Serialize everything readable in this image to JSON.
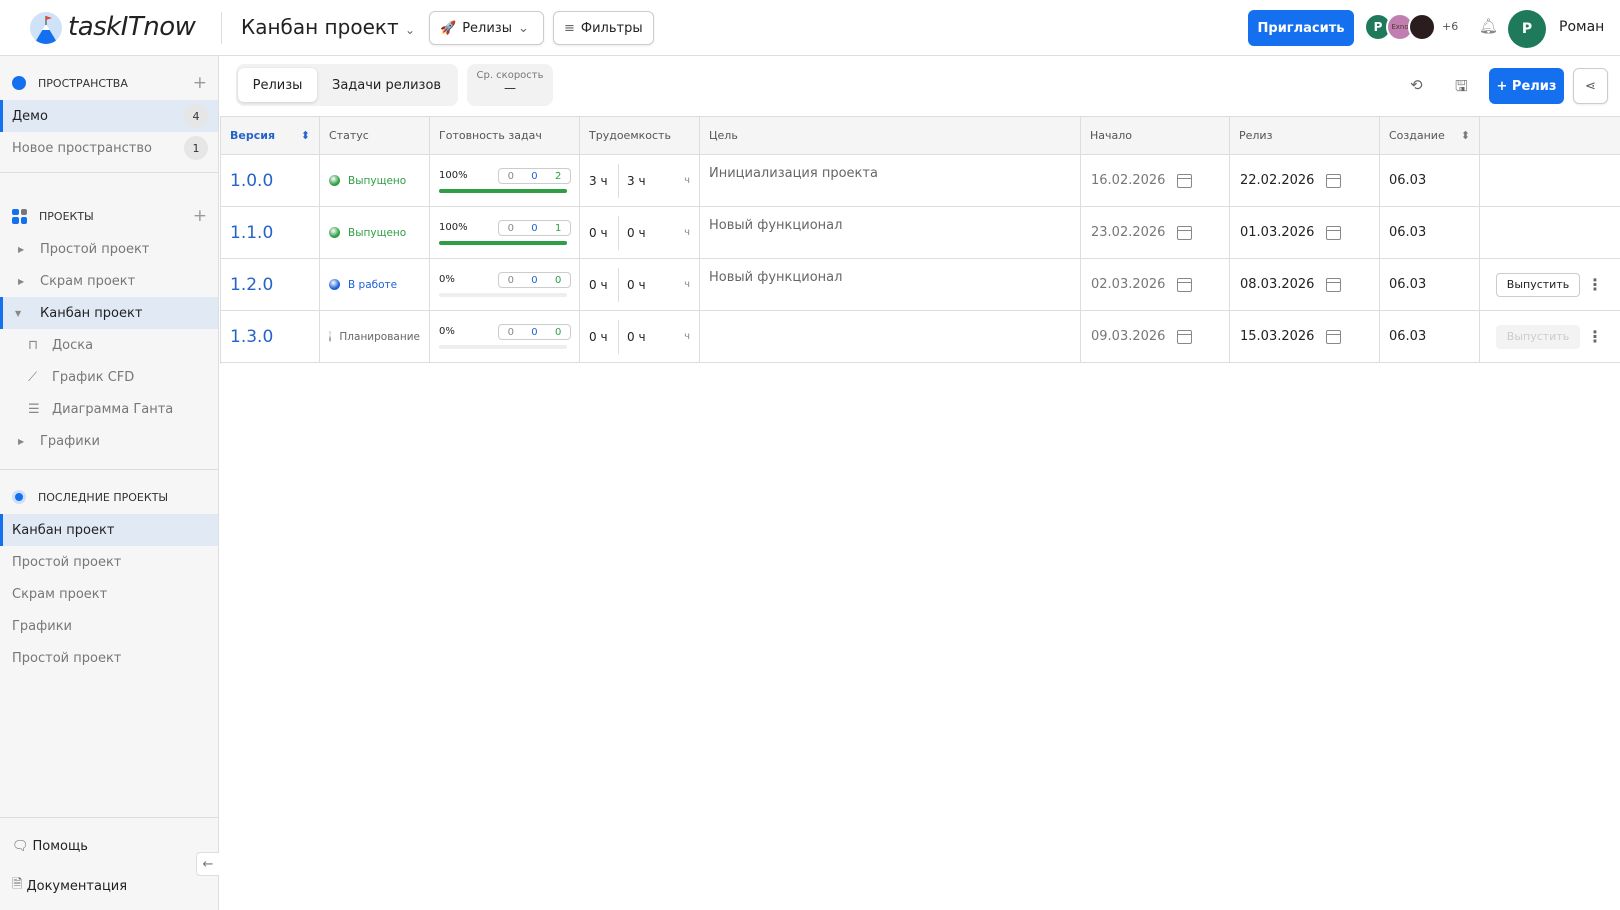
{
  "header": {
    "logo_text": "taskITnow",
    "project_title": "Канбан проект",
    "releases_label": "Релизы",
    "filters_label": "Фильтры",
    "invite_label": "Пригласить",
    "avatars": [
      {
        "initial": "Р",
        "color": "#1e7a5a"
      },
      {
        "initial": "Exno",
        "color": "#c07fb0"
      },
      {
        "initial": "",
        "color": "#2b1d1d"
      }
    ],
    "more_users": "+6",
    "user_initial": "Р",
    "user_name": "Роман",
    "user_color": "#1e7a5a"
  },
  "sidebar": {
    "spaces_title": "ПРОСТРАНСТВА",
    "spaces": [
      {
        "label": "Демо",
        "count": "4",
        "active": true
      },
      {
        "label": "Новое пространство",
        "count": "1"
      }
    ],
    "projects_title": "ПРОЕКТЫ",
    "projects": [
      {
        "label": "Простой проект"
      },
      {
        "label": "Скрам проект"
      },
      {
        "label": "Канбан проект",
        "active": true,
        "expanded": true
      }
    ],
    "sub_items": [
      {
        "label": "Доска",
        "icon": "board-icon"
      },
      {
        "label": "График CFD",
        "icon": "chart-icon"
      },
      {
        "label": "Диаграмма Ганта",
        "icon": "gantt-icon"
      }
    ],
    "charts_label": "Графики",
    "recent_title": "ПОСЛЕДНИЕ ПРОЕКТЫ",
    "recent": [
      {
        "label": "Канбан проект",
        "active": true
      },
      {
        "label": "Простой проект"
      },
      {
        "label": "Скрам проект"
      },
      {
        "label": "Графики"
      },
      {
        "label": "Простой проект"
      }
    ],
    "help_label": "Помощь",
    "docs_label": "Документация"
  },
  "toolbar": {
    "tab_releases": "Релизы",
    "tab_tasks": "Задачи релизов",
    "velocity_label": "Ср. скорость",
    "velocity_value": "—",
    "add_release_label": "+ Релиз"
  },
  "table": {
    "columns": [
      "Версия",
      "Статус",
      "Готовность задач",
      "Трудоемкость",
      "Цель",
      "Начало",
      "Релиз",
      "Создание",
      ""
    ],
    "rows": [
      {
        "version": "1.0.0",
        "status": "Выпущено",
        "status_color": "#2f9e44",
        "pct": "100%",
        "progress": 100,
        "c1": "0",
        "c2": "0",
        "c3": "2",
        "est": "3 ч",
        "spent": "3 ч",
        "unit": "ч",
        "goal": "Инициализация проекта",
        "start": "16.02.2026",
        "release": "22.02.2026",
        "created": "06.03",
        "action": ""
      },
      {
        "version": "1.1.0",
        "status": "Выпущено",
        "status_color": "#2f9e44",
        "pct": "100%",
        "progress": 100,
        "c1": "0",
        "c2": "0",
        "c3": "1",
        "est": "0 ч",
        "spent": "0 ч",
        "unit": "ч",
        "goal": "Новый функционал",
        "start": "23.02.2026",
        "release": "01.03.2026",
        "created": "06.03",
        "action": ""
      },
      {
        "version": "1.2.0",
        "status": "В работе",
        "status_color": "#1d5fd6",
        "pct": "0%",
        "progress": 0,
        "c1": "0",
        "c2": "0",
        "c3": "0",
        "est": "0 ч",
        "spent": "0 ч",
        "unit": "ч",
        "goal": "Новый функционал",
        "start": "02.03.2026",
        "release": "08.03.2026",
        "created": "06.03",
        "action": "Выпустить",
        "action_enabled": true
      },
      {
        "version": "1.3.0",
        "status": "Планирование",
        "status_color": "#999999",
        "pct": "0%",
        "progress": 0,
        "c1": "0",
        "c2": "0",
        "c3": "0",
        "est": "0 ч",
        "spent": "0 ч",
        "unit": "ч",
        "goal": "",
        "start": "09.03.2026",
        "release": "15.03.2026",
        "created": "06.03",
        "action": "Выпустить",
        "action_enabled": false
      }
    ]
  }
}
